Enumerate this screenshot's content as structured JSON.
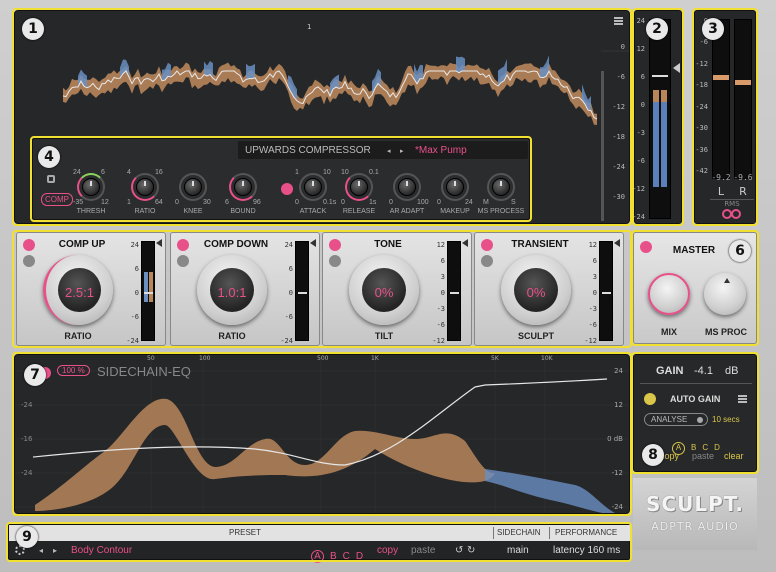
{
  "app": {
    "brand": "SCULPT.",
    "brand_sub": "ADPTR AUDIO"
  },
  "colors": {
    "accent": "#e8508a",
    "highlight": "#f2e030",
    "waveform_brown": "#b9865a",
    "waveform_blue": "#6a8fc2"
  },
  "badges": [
    "1",
    "2",
    "3",
    "4",
    "5",
    "6",
    "7",
    "8",
    "9"
  ],
  "top_display": {
    "marker": "1",
    "scale": [
      "0",
      "-6",
      "-12",
      "-18",
      "-24",
      "-30",
      "-36"
    ]
  },
  "input_meter": {
    "scale": [
      "24",
      "12",
      "6",
      "0",
      "-3",
      "-6",
      "-12",
      "-24"
    ]
  },
  "rms_meter": {
    "scale": [
      "0",
      "-6",
      "-12",
      "-18",
      "-24",
      "-30",
      "-36",
      "-42"
    ],
    "left_value": "-9.2",
    "right_value": "-9.6",
    "left_label": "L",
    "right_label": "R",
    "caption": "RMS"
  },
  "upwards": {
    "title": "UPWARDS COMPRESSOR",
    "preset": "*Max Pump",
    "comp_label": "COMP",
    "knobs": [
      {
        "name": "THRESH",
        "min": "-35",
        "max": "12",
        "top_l": "24",
        "top_r": "6"
      },
      {
        "name": "RATIO",
        "min": "1",
        "max": "64",
        "top_l": "4",
        "top_r": "16"
      },
      {
        "name": "KNEE",
        "min": "0",
        "max": "30",
        "top_l": "",
        "top_r": ""
      },
      {
        "name": "BOUND",
        "min": "6",
        "max": "96",
        "top_l": "",
        "top_r": ""
      },
      {
        "name": "ATTACK",
        "min": "0",
        "max": "0.1s",
        "top_l": "1",
        "top_r": "10"
      },
      {
        "name": "RELEASE",
        "min": "0",
        "max": "1s",
        "top_l": "10",
        "top_r": "0.1"
      },
      {
        "name": "AR ADAPT",
        "min": "0",
        "max": "100",
        "top_l": "",
        "top_r": ""
      },
      {
        "name": "MAKEUP",
        "min": "0",
        "max": "24",
        "top_l": "",
        "top_r": ""
      },
      {
        "name": "MS PROCESS",
        "min": "M",
        "max": "S",
        "top_l": "",
        "top_r": ""
      }
    ]
  },
  "modules": [
    {
      "title": "COMP UP",
      "value": "2.5:1",
      "label": "RATIO",
      "scale": [
        "24",
        "6",
        "0",
        "-6",
        "-24"
      ]
    },
    {
      "title": "COMP DOWN",
      "value": "1.0:1",
      "label": "RATIO",
      "scale": [
        "24",
        "6",
        "0",
        "-6",
        "-24"
      ]
    },
    {
      "title": "TONE",
      "value": "0%",
      "label": "TILT",
      "scale": [
        "12",
        "6",
        "3",
        "0",
        "-3",
        "-6",
        "-12"
      ]
    },
    {
      "title": "TRANSIENT",
      "value": "0%",
      "label": "SCULPT",
      "scale": [
        "12",
        "6",
        "3",
        "0",
        "-3",
        "-6",
        "-12"
      ]
    }
  ],
  "master": {
    "title": "MASTER",
    "mix_label": "MIX",
    "ms_label": "MS PROC"
  },
  "sidechain": {
    "percent": "100 %",
    "title": "SIDECHAIN-EQ",
    "freq": [
      "50",
      "100",
      "500",
      "1K",
      "5K",
      "10K"
    ],
    "db_right": [
      "24",
      "12",
      "0 dB",
      "-12",
      "-24"
    ],
    "db_left": [
      "-24",
      "-16",
      "-24"
    ]
  },
  "gain": {
    "label": "GAIN",
    "value": "-4.1",
    "unit": "dB",
    "auto_gain": "AUTO GAIN",
    "analyse": "ANALYSE",
    "duration": "10 secs",
    "slots": [
      "A",
      "B",
      "C",
      "D"
    ],
    "copy": "copy",
    "paste": "paste",
    "clear": "clear"
  },
  "footer": {
    "preset_header": "PRESET",
    "sidechain_header": "SIDECHAIN",
    "performance_header": "PERFORMANCE",
    "preset_name": "Body Contour",
    "slots": [
      "A",
      "B",
      "C",
      "D"
    ],
    "copy": "copy",
    "paste": "paste",
    "sidechain_value": "main",
    "latency": "latency 160 ms"
  }
}
